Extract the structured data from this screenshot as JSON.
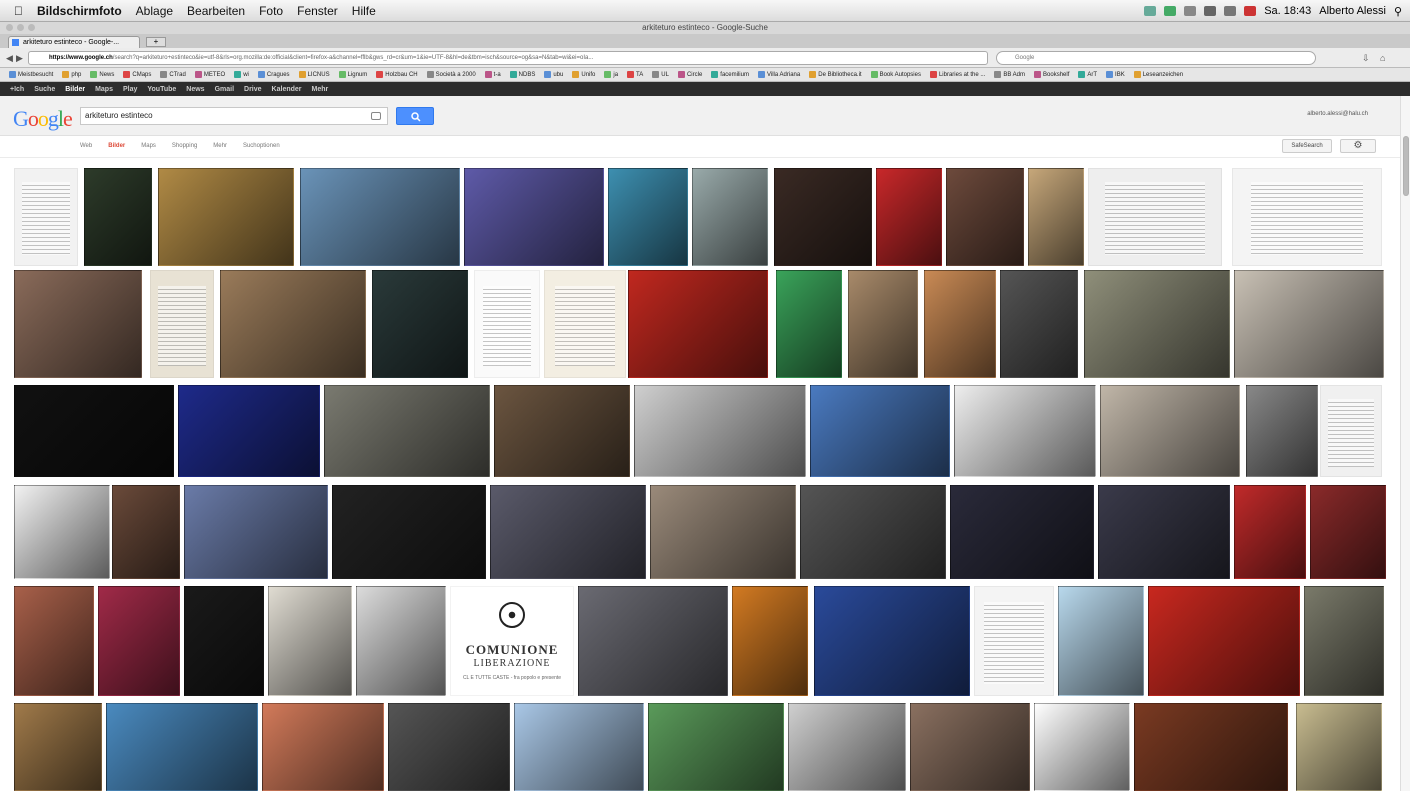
{
  "menubar": {
    "items": [
      "Bildschirmfoto",
      "Ablage",
      "Bearbeiten",
      "Foto",
      "Fenster",
      "Hilfe"
    ],
    "clock": "Sa. 18:43",
    "user": "Alberto Alessi"
  },
  "window": {
    "title": "arkiteturo estinteco - Google-Suche"
  },
  "tab": {
    "label": "arkiteturo estinteco - Google-..."
  },
  "url": {
    "host": "https://www.google.ch",
    "path": "/search?q=arkiteturo+estinteco&ie=utf-8&rls=org.mozilla:de:official&client=firefox-a&channel=fflb&gws_rd=cr&um=1&ie=UTF-8&hl=de&tbm=isch&source=og&sa=N&tab=wi&ei=oIa..."
  },
  "search_bar": {
    "placeholder": "Google"
  },
  "bookmarks": [
    "Meistbesucht",
    "php",
    "News",
    "CMaps",
    "CTrad",
    "METEO",
    "wi",
    "Cragues",
    "LICNUS",
    "Lignum",
    "Holzbau CH",
    "Società a 2000",
    "t-a",
    "NDBS",
    "ubu",
    "Unifo",
    "ja",
    "TA",
    "UL",
    "Circle",
    "facemilium",
    "Villa Adriana",
    "De Bibliotheca.it",
    "Book Autopsies",
    "Libraries at the ...",
    "BB Adm",
    "Bookshelf",
    "ArT",
    "IBK",
    "Leseanzeichen"
  ],
  "google_bar": [
    "+Ich",
    "Suche",
    "Bilder",
    "Maps",
    "Play",
    "YouTube",
    "News",
    "Gmail",
    "Drive",
    "Kalender",
    "Mehr"
  ],
  "google_bar_active": "Bilder",
  "logo": "Google",
  "query": "arkiteturo estinteco",
  "account": "alberto.alessi@halu.ch",
  "filters": {
    "tabs": [
      "Web",
      "Bilder",
      "Maps",
      "Shopping",
      "Mehr",
      "Suchoptionen"
    ],
    "active": "Bilder"
  },
  "safesearch": "SafeSearch",
  "thumbnail_captions": {
    "comunione": {
      "line1": "COMUNIONE",
      "line2": "LIBERAZIONE",
      "line3": "CL E TUTTE CASTE - fra popolo e presente"
    }
  },
  "colors": {
    "accent": "#4d90fe",
    "active_tab": "#dd4b39",
    "gbar": "#2d2d2d"
  }
}
